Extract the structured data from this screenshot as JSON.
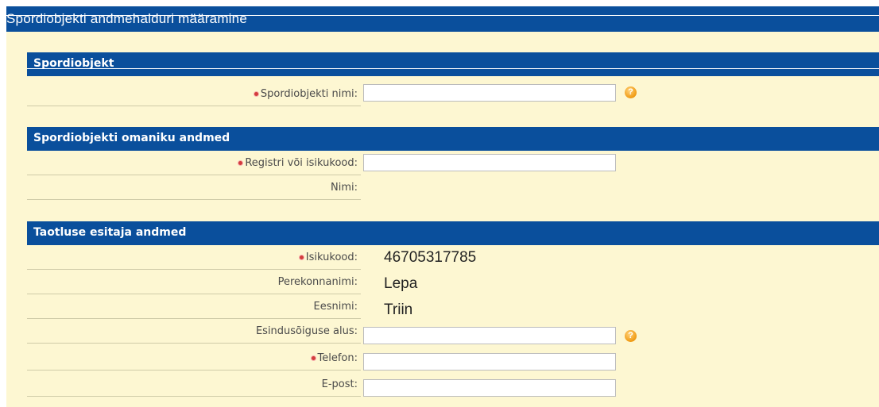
{
  "page_title": "Spordiobjekti andmehalduri määramine",
  "sections": {
    "object": {
      "title": "Spordiobjekt"
    },
    "owner": {
      "title": "Spordiobjekti omaniku andmed"
    },
    "applicant": {
      "title": "Taotluse esitaja andmed"
    }
  },
  "fields": {
    "object_name": {
      "label": "Spordiobjekti nimi:",
      "value": "",
      "required": true
    },
    "reg_code": {
      "label": "Registri või isikukood:",
      "value": "",
      "required": true
    },
    "owner_name": {
      "label": "Nimi:",
      "value": ""
    },
    "isikukood": {
      "label": "Isikukood:",
      "value": "46705317785",
      "required": true
    },
    "perekonnanimi": {
      "label": "Perekonnanimi:",
      "value": "Lepa"
    },
    "eesnimi": {
      "label": "Eesnimi:",
      "value": "Triin"
    },
    "esindusoigus": {
      "label": "Esindusõiguse alus:",
      "value": ""
    },
    "telefon": {
      "label": "Telefon:",
      "value": "",
      "required": true
    },
    "epost": {
      "label": "E-post:",
      "value": ""
    }
  },
  "help_glyph": "?",
  "colors": {
    "header_bg": "#0a4f9c",
    "page_bg": "#fdf7d2",
    "required": "#d33c3c",
    "help": "#f09a12"
  }
}
